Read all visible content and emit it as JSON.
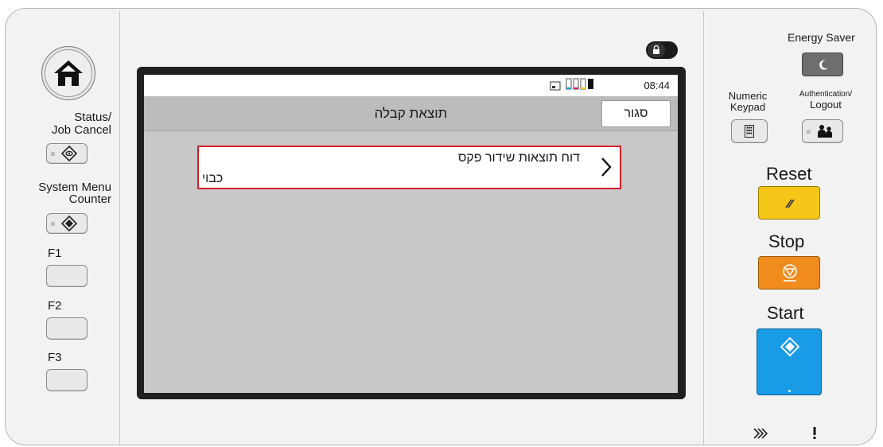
{
  "left_panel": {
    "status_label_1": "Status/",
    "status_label_2": "Job Cancel",
    "system_menu_label_1": "System Menu",
    "system_menu_label_2": "Counter",
    "f1_label": "F1",
    "f2_label": "F2",
    "f3_label": "F3"
  },
  "screen": {
    "time": "08:44",
    "title": "תוצאת קבלה",
    "close_label": "סגור",
    "item": {
      "title": "דוח תוצאות שידור פקס",
      "value": "כבוי"
    }
  },
  "right_panel": {
    "energy_saver_label": "Energy Saver",
    "numeric_keypad_label_1": "Numeric",
    "numeric_keypad_label_2": "Keypad",
    "auth_label_1": "Authentication/",
    "auth_label_2": "Logout",
    "reset_label": "Reset",
    "stop_label": "Stop",
    "start_label": "Start"
  },
  "colors": {
    "reset": "#f5c518",
    "stop": "#f08c1e",
    "start": "#1a9be6",
    "highlight_border": "#d81f26"
  },
  "icons": [
    "home-icon",
    "status-icon",
    "system-menu-icon",
    "lock-icon",
    "sim-icon",
    "toner-icon",
    "energy-saver-icon",
    "numeric-keypad-icon",
    "authentication-icon",
    "reset-icon",
    "stop-icon",
    "start-icon",
    "data-indicator-icon",
    "attention-icon"
  ]
}
